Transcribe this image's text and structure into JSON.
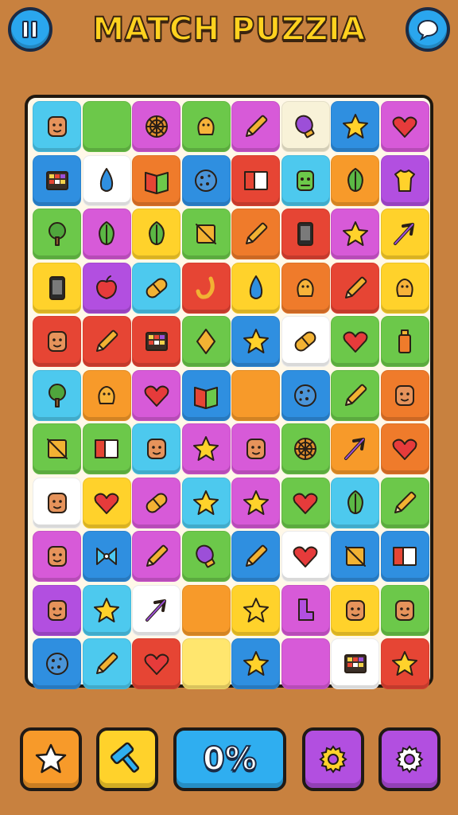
{
  "header": {
    "title": "MATCH PUZZIA",
    "pause_icon": "pause-icon",
    "chat_icon": "chat-bubble-icon"
  },
  "colors": {
    "background": "#c8813f",
    "board": "#fff8e8",
    "title": "#ffd21f",
    "round_button": "#2aa6ee"
  },
  "board": {
    "rows": 11,
    "cols": 8,
    "tiles": [
      [
        {
          "c": "#4dc9ee",
          "i": "face"
        },
        {
          "c": "#6cc84a",
          "i": "blank"
        },
        {
          "c": "#d75ad8",
          "i": "wheel"
        },
        {
          "c": "#6cc84a",
          "i": "blob"
        },
        {
          "c": "#d75ad8",
          "i": "pencil"
        },
        {
          "c": "#f8f2d8",
          "i": "bulb"
        },
        {
          "c": "#2f8fe0",
          "i": "star"
        },
        {
          "c": "#d75ad8",
          "i": "heart"
        }
      ],
      [
        {
          "c": "#2f8fe0",
          "i": "grid"
        },
        {
          "c": "#ffffff",
          "i": "drop"
        },
        {
          "c": "#ef7b2b",
          "i": "book"
        },
        {
          "c": "#2f8fe0",
          "i": "cookie"
        },
        {
          "c": "#e64534",
          "i": "flag"
        },
        {
          "c": "#4dc9ee",
          "i": "robot"
        },
        {
          "c": "#f79a2a",
          "i": "leaf"
        },
        {
          "c": "#b24fe0",
          "i": "shirt"
        }
      ],
      [
        {
          "c": "#6cc84a",
          "i": "tree"
        },
        {
          "c": "#d75ad8",
          "i": "leaf"
        },
        {
          "c": "#ffd22b",
          "i": "leaf"
        },
        {
          "c": "#6cc84a",
          "i": "slash"
        },
        {
          "c": "#ef7b2b",
          "i": "pencil"
        },
        {
          "c": "#e64534",
          "i": "phone"
        },
        {
          "c": "#d75ad8",
          "i": "star"
        },
        {
          "c": "#ffd22b",
          "i": "arrow"
        }
      ],
      [
        {
          "c": "#ffd22b",
          "i": "phone"
        },
        {
          "c": "#b24fe0",
          "i": "apple"
        },
        {
          "c": "#4dc9ee",
          "i": "pill"
        },
        {
          "c": "#e64534",
          "i": "hook"
        },
        {
          "c": "#ffd22b",
          "i": "drop"
        },
        {
          "c": "#ef7b2b",
          "i": "blob"
        },
        {
          "c": "#e64534",
          "i": "pencil"
        },
        {
          "c": "#ffd22b",
          "i": "blob"
        }
      ],
      [
        {
          "c": "#e64534",
          "i": "face"
        },
        {
          "c": "#e64534",
          "i": "pencil"
        },
        {
          "c": "#e64534",
          "i": "grid"
        },
        {
          "c": "#6cc84a",
          "i": "diamond"
        },
        {
          "c": "#2f8fe0",
          "i": "star"
        },
        {
          "c": "#ffffff",
          "i": "pill"
        },
        {
          "c": "#6cc84a",
          "i": "heart"
        },
        {
          "c": "#6cc84a",
          "i": "bottle"
        }
      ],
      [
        {
          "c": "#4dc9ee",
          "i": "tree"
        },
        {
          "c": "#f79a2a",
          "i": "blob"
        },
        {
          "c": "#d75ad8",
          "i": "heart"
        },
        {
          "c": "#2f8fe0",
          "i": "book"
        },
        {
          "c": "#f79a2a",
          "i": "blank"
        },
        {
          "c": "#2f8fe0",
          "i": "cookie"
        },
        {
          "c": "#6cc84a",
          "i": "pencil"
        },
        {
          "c": "#ef7b2b",
          "i": "face"
        }
      ],
      [
        {
          "c": "#6cc84a",
          "i": "slash"
        },
        {
          "c": "#6cc84a",
          "i": "flag"
        },
        {
          "c": "#4dc9ee",
          "i": "face"
        },
        {
          "c": "#d75ad8",
          "i": "star"
        },
        {
          "c": "#d75ad8",
          "i": "face"
        },
        {
          "c": "#6cc84a",
          "i": "wheel"
        },
        {
          "c": "#f79a2a",
          "i": "arrow"
        },
        {
          "c": "#ef7b2b",
          "i": "heart"
        }
      ],
      [
        {
          "c": "#ffffff",
          "i": "face"
        },
        {
          "c": "#ffd22b",
          "i": "heart"
        },
        {
          "c": "#d75ad8",
          "i": "pill"
        },
        {
          "c": "#4dc9ee",
          "i": "star"
        },
        {
          "c": "#d75ad8",
          "i": "star"
        },
        {
          "c": "#6cc84a",
          "i": "heart"
        },
        {
          "c": "#4dc9ee",
          "i": "leaf"
        },
        {
          "c": "#6cc84a",
          "i": "pencil"
        }
      ],
      [
        {
          "c": "#d75ad8",
          "i": "face"
        },
        {
          "c": "#2f8fe0",
          "i": "bow"
        },
        {
          "c": "#d75ad8",
          "i": "pencil"
        },
        {
          "c": "#6cc84a",
          "i": "bulb"
        },
        {
          "c": "#2f8fe0",
          "i": "pencil"
        },
        {
          "c": "#ffffff",
          "i": "heart"
        },
        {
          "c": "#2f8fe0",
          "i": "slash"
        },
        {
          "c": "#2f8fe0",
          "i": "flag"
        }
      ],
      [
        {
          "c": "#b24fe0",
          "i": "face"
        },
        {
          "c": "#4dc9ee",
          "i": "star"
        },
        {
          "c": "#ffffff",
          "i": "arrow"
        },
        {
          "c": "#f79a2a",
          "i": "blank"
        },
        {
          "c": "#ffd22b",
          "i": "star"
        },
        {
          "c": "#d75ad8",
          "i": "boot"
        },
        {
          "c": "#ffd22b",
          "i": "face"
        },
        {
          "c": "#6cc84a",
          "i": "face"
        }
      ],
      [
        {
          "c": "#2f8fe0",
          "i": "cookie"
        },
        {
          "c": "#4dc9ee",
          "i": "pencil"
        },
        {
          "c": "#e64534",
          "i": "heart"
        },
        {
          "c": "#ffe66e",
          "i": "blank"
        },
        {
          "c": "#2f8fe0",
          "i": "star"
        },
        {
          "c": "#d75ad8",
          "i": "blank"
        },
        {
          "c": "#ffffff",
          "i": "grid"
        },
        {
          "c": "#e64534",
          "i": "star"
        }
      ]
    ]
  },
  "toolbar": {
    "star_icon": "star-icon",
    "hint_icon": "hammer-icon",
    "progress_text": "0%",
    "progress_value": 0,
    "settings_icon": "gear-icon",
    "options_icon": "gear-icon",
    "colors": {
      "star": "#f79a2a",
      "hint": "#ffd22b",
      "progress": "#2faef0",
      "settings": "#b24fe0",
      "options": "#b24fe0"
    }
  }
}
